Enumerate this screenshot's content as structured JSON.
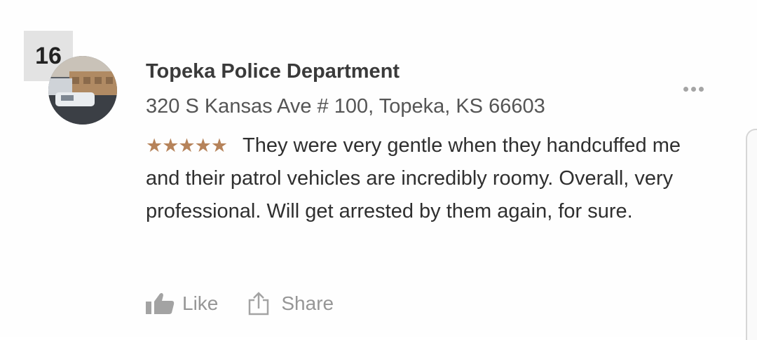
{
  "rank": "16",
  "business": {
    "name": "Topeka Police Department",
    "address": "320 S Kansas Ave # 100, Topeka, KS 66603",
    "avatar_icon": "police-building-photo"
  },
  "review": {
    "rating": 5,
    "stars": "★★★★★",
    "text": "They were very gentle when they handcuffed me and their patrol vehicles are incredibly roomy. Overall, very professional. Will get arrested by them again, for sure."
  },
  "actions": {
    "like_label": "Like",
    "share_label": "Share"
  },
  "icons": {
    "more": "more-options-icon",
    "like": "thumbs-up-icon",
    "share": "share-icon"
  },
  "colors": {
    "stars": "#b6835a",
    "badge_bg": "#e3e3e3",
    "text": "#2f2f2f",
    "muted": "#969696"
  }
}
